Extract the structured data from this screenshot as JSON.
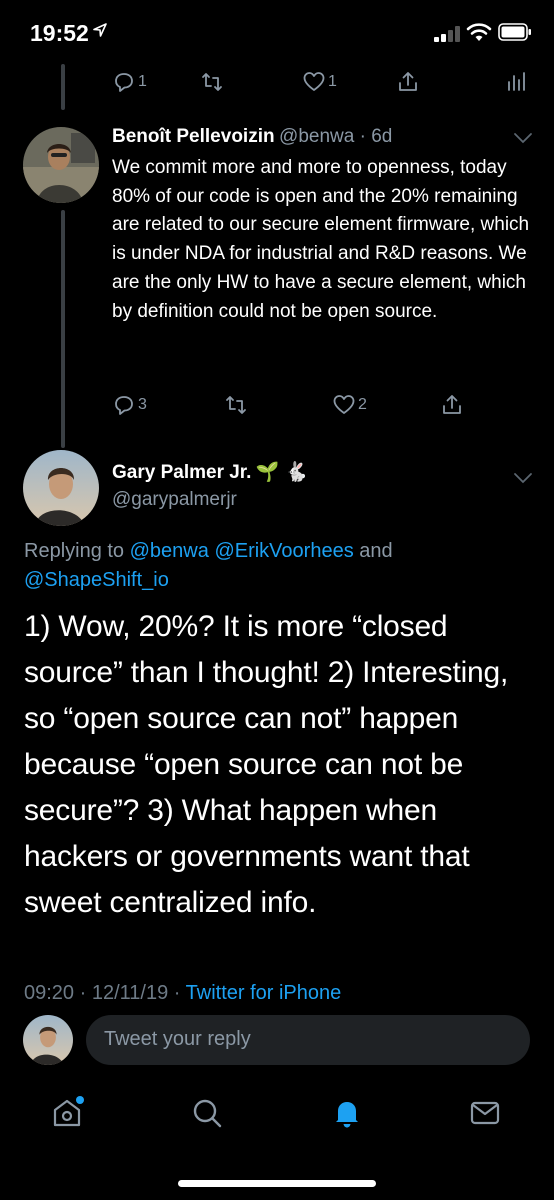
{
  "status_bar": {
    "time": "19:52"
  },
  "previous_actions": {
    "replies": "1",
    "likes": "1"
  },
  "parent_tweet": {
    "author_name": "Benoît Pellevoizin",
    "author_handle": "@benwa",
    "age": "6d",
    "text": "We commit more and more to openness, today 80% of our code is open and the 20% remaining are related to our secure element firmware, which is under NDA for industrial and R&D reasons. We are the only HW to have a secure element, which by definition could not be open source.",
    "replies": "3",
    "likes": "2"
  },
  "main_tweet": {
    "author_name": "Gary Palmer Jr.",
    "author_emoji": "🌱 🐇",
    "author_handle": "@garypalmerjr",
    "replying_prefix": "Replying to",
    "mention_1": "@benwa",
    "mention_2": "@ErikVoorhees",
    "mention_joiner": "and",
    "mention_3": "@ShapeShift_io",
    "text": "1) Wow, 20%? It is more “closed source” than I thought! 2) Interesting, so “open source can not” happen because “open source can not be secure”? 3) What happen when hackers or governments want that sweet centralized info.",
    "time": "09:20",
    "date": "12/11/19",
    "source": "Twitter for iPhone"
  },
  "reply_box": {
    "placeholder": "Tweet your reply"
  },
  "colors": {
    "accent": "#1da1f2",
    "muted": "#8b98a5",
    "background": "#000000"
  }
}
